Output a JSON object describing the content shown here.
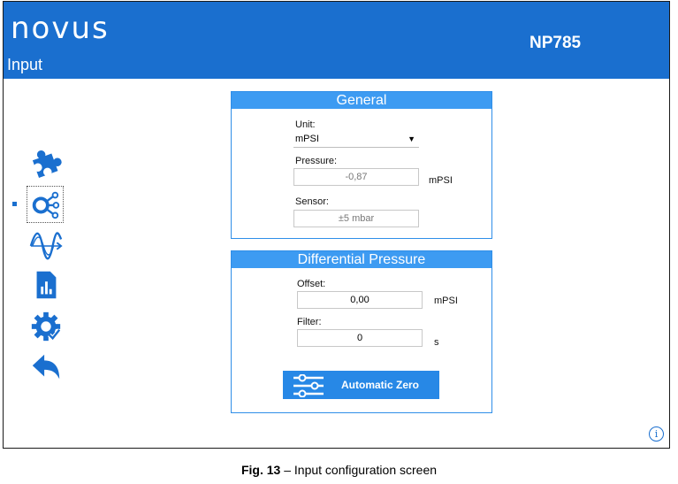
{
  "header": {
    "logo": "novus",
    "title": "Input",
    "device": "NP785"
  },
  "colors": {
    "header": "#1a6fcf",
    "panel_head": "#3d9bf2",
    "button": "#2788e6",
    "icon": "#1a6fcf"
  },
  "sidebar": {
    "items": [
      {
        "icon": "puzzle-icon"
      },
      {
        "icon": "input-nodes-icon",
        "selected": true
      },
      {
        "icon": "signal-wave-icon"
      },
      {
        "icon": "report-chart-icon"
      },
      {
        "icon": "gear-check-icon"
      },
      {
        "icon": "back-arrow-icon"
      }
    ]
  },
  "general": {
    "title": "General",
    "unit_label": "Unit:",
    "unit_value": "mPSI",
    "pressure_label": "Pressure:",
    "pressure_value": "-0,87",
    "pressure_unit": "mPSI",
    "sensor_label": "Sensor:",
    "sensor_value": "±5 mbar"
  },
  "differential": {
    "title": "Differential Pressure",
    "offset_label": "Offset:",
    "offset_value": "0,00",
    "offset_unit": "mPSI",
    "filter_label": "Filter:",
    "filter_value": "0",
    "filter_unit": "s",
    "auto_zero_label": "Automatic Zero"
  },
  "info_icon": "i",
  "caption": {
    "fig": "Fig. 13",
    "text": " – Input configuration screen"
  }
}
